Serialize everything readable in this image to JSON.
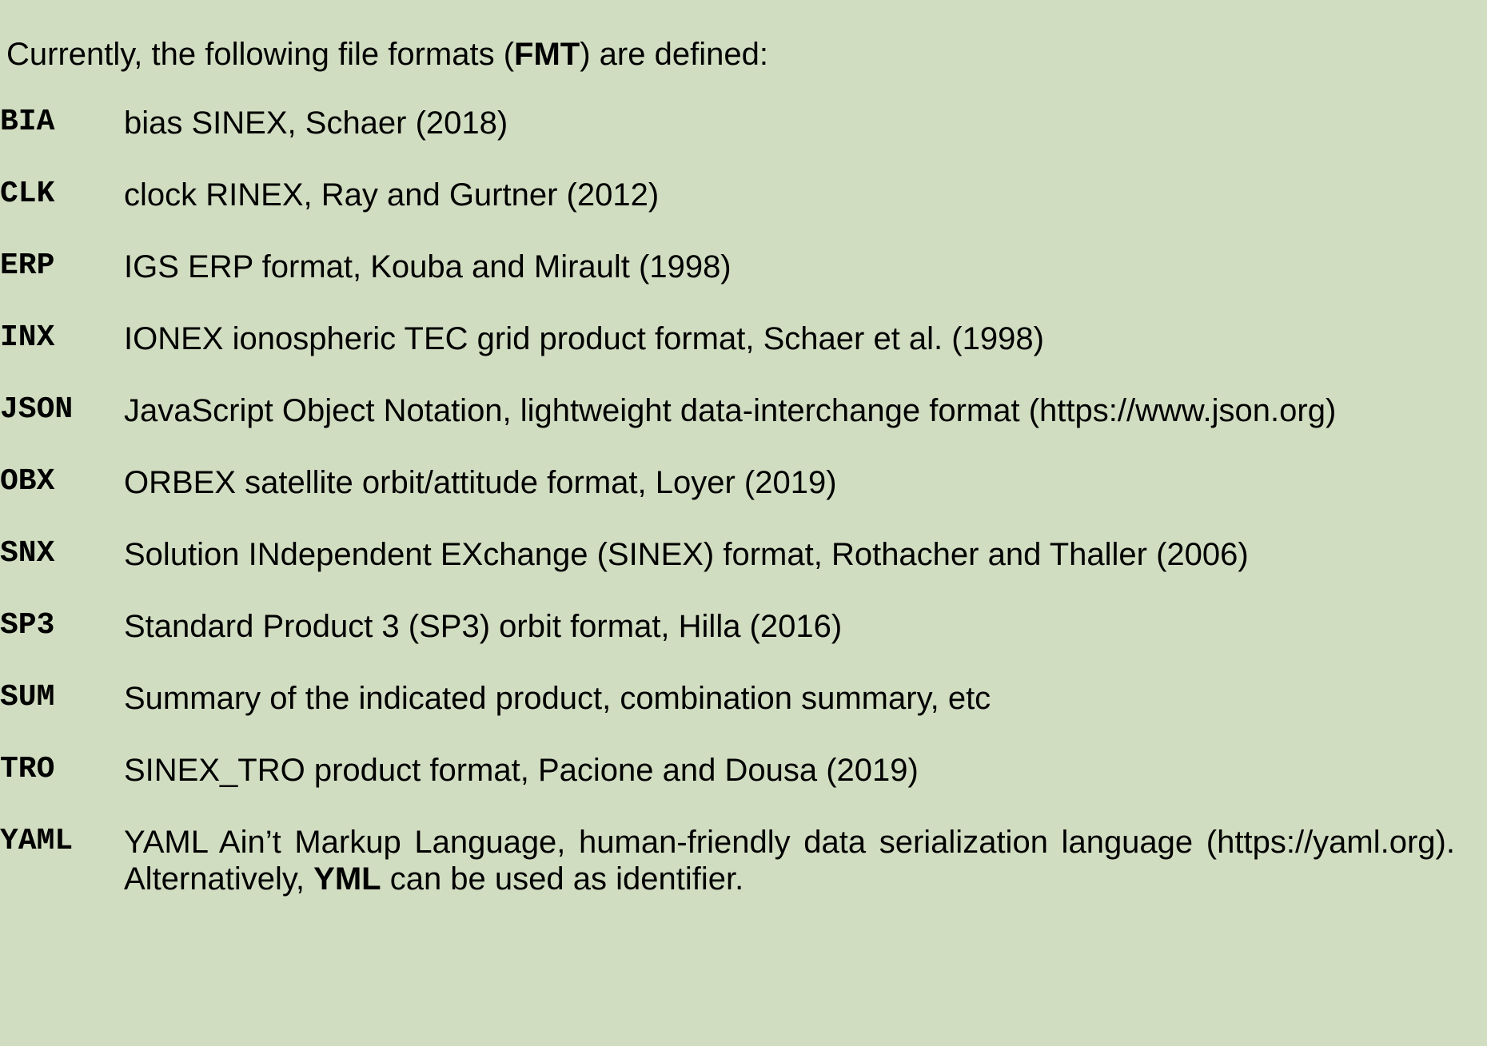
{
  "intro": {
    "text_before": "Currently, the following file formats (",
    "fmt_tag": "FMT",
    "text_after": ") are defined:"
  },
  "formats": [
    {
      "code": "BIA",
      "description": "bias SINEX, Schaer (2018)",
      "wrap": false
    },
    {
      "code": "CLK",
      "description": "clock RINEX, Ray and Gurtner (2012)",
      "wrap": false
    },
    {
      "code": "ERP",
      "description": "IGS ERP format, Kouba and Mirault (1998)",
      "wrap": false
    },
    {
      "code": "INX",
      "description": "IONEX ionospheric TEC grid product format, Schaer et al. (1998)",
      "wrap": false
    },
    {
      "code": "JSON",
      "description": "JavaScript Object Notation, lightweight data-interchange format (https://www.json.org)",
      "wrap": true
    },
    {
      "code": "OBX",
      "description": "ORBEX satellite orbit/attitude format, Loyer (2019)",
      "wrap": false
    },
    {
      "code": "SNX",
      "description": "Solution INdependent EXchange (SINEX) format, Rothacher and Thaller (2006)",
      "wrap": true
    },
    {
      "code": "SP3",
      "description": "Standard Product 3 (SP3) orbit format, Hilla (2016)",
      "wrap": false
    },
    {
      "code": "SUM",
      "description": "Summary of the indicated product, combination summary, etc",
      "wrap": false
    },
    {
      "code": "TRO",
      "description": "SINEX_TRO product format, Pacione and Dousa (2019)",
      "wrap": false
    },
    {
      "code": "YAML",
      "description_part1": "YAML Ain’t Markup Language, human-friendly data serialization language (https://yaml.org). Alternatively, ",
      "alt_code": "YML",
      "description_part2": " can be used as identifier.",
      "wrap": true
    }
  ],
  "colors": {
    "background": "#d1ddc1",
    "text": "#000000"
  }
}
